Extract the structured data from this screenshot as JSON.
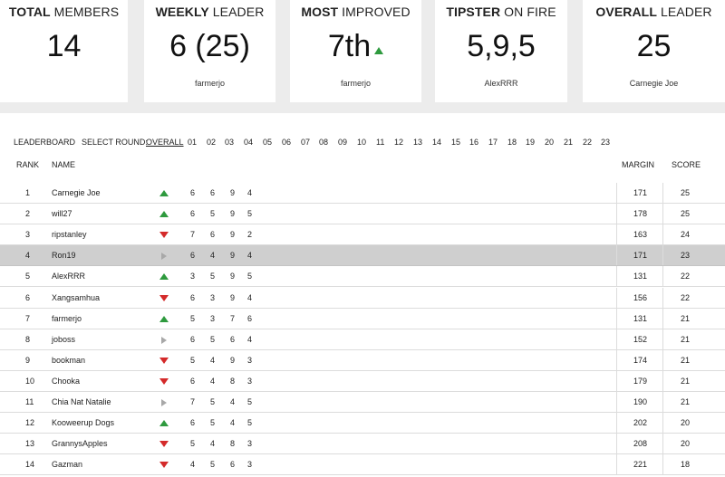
{
  "cards": [
    {
      "title_bold": "TOTAL",
      "title_rest": " MEMBERS",
      "value": "14",
      "sub": ""
    },
    {
      "title_bold": "WEEKLY",
      "title_rest": " LEADER",
      "value": "6 (25)",
      "sub": "farmerjo"
    },
    {
      "title_bold": "MOST",
      "title_rest": " IMPROVED",
      "value": "7th",
      "sub": "farmerjo"
    },
    {
      "title_bold": "TIPSTER",
      "title_rest": " ON FIRE",
      "value": "5,9,5",
      "sub": "AlexRRR"
    },
    {
      "title_bold": "OVERALL",
      "title_rest": " LEADER",
      "value": "25",
      "sub": "Carnegie Joe"
    }
  ],
  "leaderboard": {
    "label": "LEADERBOARD",
    "select_round_label": "SELECT ROUND:",
    "rounds": [
      "OVERALL",
      "01",
      "02",
      "03",
      "04",
      "05",
      "06",
      "07",
      "08",
      "09",
      "10",
      "11",
      "12",
      "13",
      "14",
      "15",
      "16",
      "17",
      "18",
      "19",
      "20",
      "21",
      "22",
      "23"
    ],
    "headers": {
      "rank": "RANK",
      "name": "NAME",
      "margin": "MARGIN",
      "score": "SCORE"
    },
    "rows": [
      {
        "rank": "1",
        "name": "Carnegie Joe",
        "trend": "up",
        "r": [
          "6",
          "6",
          "9",
          "4"
        ],
        "margin": "171",
        "score": "25"
      },
      {
        "rank": "2",
        "name": "will27",
        "trend": "up",
        "r": [
          "6",
          "5",
          "9",
          "5"
        ],
        "margin": "178",
        "score": "25"
      },
      {
        "rank": "3",
        "name": "ripstanley",
        "trend": "down",
        "r": [
          "7",
          "6",
          "9",
          "2"
        ],
        "margin": "163",
        "score": "24"
      },
      {
        "rank": "4",
        "name": "Ron19",
        "trend": "same",
        "r": [
          "6",
          "4",
          "9",
          "4"
        ],
        "margin": "171",
        "score": "23"
      },
      {
        "rank": "5",
        "name": "AlexRRR",
        "trend": "up",
        "r": [
          "3",
          "5",
          "9",
          "5"
        ],
        "margin": "131",
        "score": "22"
      },
      {
        "rank": "6",
        "name": "Xangsamhua",
        "trend": "down",
        "r": [
          "6",
          "3",
          "9",
          "4"
        ],
        "margin": "156",
        "score": "22"
      },
      {
        "rank": "7",
        "name": "farmerjo",
        "trend": "up",
        "r": [
          "5",
          "3",
          "7",
          "6"
        ],
        "margin": "131",
        "score": "21"
      },
      {
        "rank": "8",
        "name": "joboss",
        "trend": "same",
        "r": [
          "6",
          "5",
          "6",
          "4"
        ],
        "margin": "152",
        "score": "21"
      },
      {
        "rank": "9",
        "name": "bookman",
        "trend": "down",
        "r": [
          "5",
          "4",
          "9",
          "3"
        ],
        "margin": "174",
        "score": "21"
      },
      {
        "rank": "10",
        "name": "Chooka",
        "trend": "down",
        "r": [
          "6",
          "4",
          "8",
          "3"
        ],
        "margin": "179",
        "score": "21"
      },
      {
        "rank": "11",
        "name": "Chia Nat Natalie",
        "trend": "same",
        "r": [
          "7",
          "5",
          "4",
          "5"
        ],
        "margin": "190",
        "score": "21"
      },
      {
        "rank": "12",
        "name": "Kooweerup Dogs",
        "trend": "up",
        "r": [
          "6",
          "5",
          "4",
          "5"
        ],
        "margin": "202",
        "score": "20"
      },
      {
        "rank": "13",
        "name": "GrannysApples",
        "trend": "down",
        "r": [
          "5",
          "4",
          "8",
          "3"
        ],
        "margin": "208",
        "score": "20"
      },
      {
        "rank": "14",
        "name": "Gazman",
        "trend": "down",
        "r": [
          "4",
          "5",
          "6",
          "3"
        ],
        "margin": "221",
        "score": "18"
      }
    ]
  }
}
